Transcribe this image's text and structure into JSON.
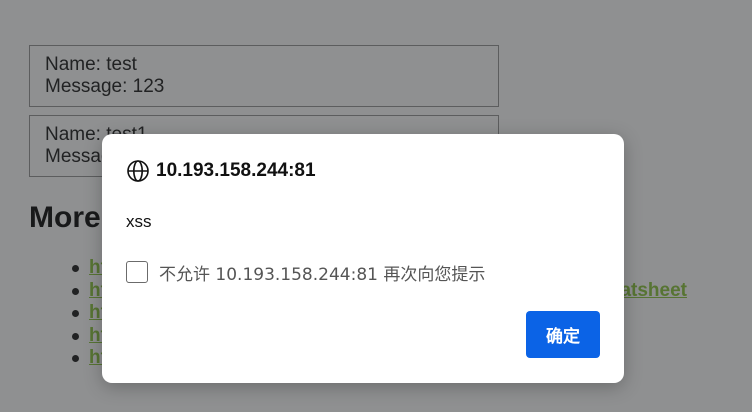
{
  "page": {
    "messages": [
      {
        "name_line": "Name: test",
        "message_line": "Message: 123"
      },
      {
        "name_line": "Name: test1",
        "message_line": "Message"
      }
    ],
    "more_heading": "More",
    "links": [
      {
        "text": "ht"
      },
      {
        "text": "ht",
        "tail": "atsheet"
      },
      {
        "text": "ht"
      },
      {
        "text": "ht"
      },
      {
        "text": "ht"
      }
    ],
    "link_color": "#8fc742"
  },
  "dialog": {
    "origin_icon": "globe-icon",
    "origin": "10.193.158.244:81",
    "message": "xss",
    "suppress_checked": false,
    "suppress_label": "不允许 10.193.158.244:81 再次向您提示",
    "ok_label": "确定",
    "ok_color": "#0b63e6"
  }
}
